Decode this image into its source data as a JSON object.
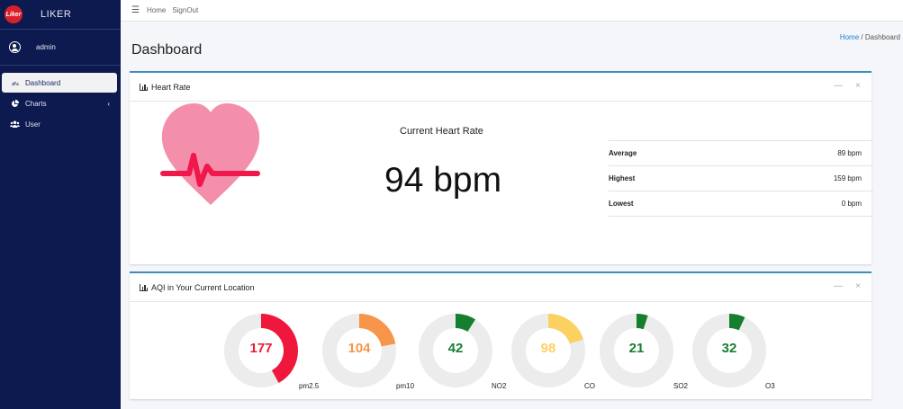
{
  "brand": {
    "name": "LIKER",
    "logo_text": "Liker"
  },
  "user": {
    "name": "admin"
  },
  "sidebar": {
    "items": [
      {
        "label": "Dashboard",
        "icon": "dashboard-icon"
      },
      {
        "label": "Charts",
        "icon": "pie-chart-icon"
      },
      {
        "label": "User",
        "icon": "users-icon"
      }
    ]
  },
  "topbar": {
    "home": "Home",
    "signout": "SignOut"
  },
  "page": {
    "title": "Dashboard"
  },
  "breadcrumb": {
    "home": "Home",
    "separator": "/",
    "current": "Dashboard"
  },
  "heart_card": {
    "title": "Heart Rate",
    "current_label": "Current Heart Rate",
    "current_value": "94 bpm",
    "stats": [
      {
        "label": "Average",
        "value": "89 bpm"
      },
      {
        "label": "Highest",
        "value": "159 bpm"
      },
      {
        "label": "Lowest",
        "value": "0 bpm"
      }
    ]
  },
  "aqi_card": {
    "title": "AQI in Your Current Location",
    "gauges": [
      {
        "value": "177",
        "label": "pm2.5",
        "fraction": 0.42,
        "color": "#f0173d"
      },
      {
        "value": "104",
        "label": "pm10",
        "fraction": 0.22,
        "color": "#f7954a"
      },
      {
        "value": "42",
        "label": "NO2",
        "fraction": 0.09,
        "color": "#157f2f"
      },
      {
        "value": "98",
        "label": "CO",
        "fraction": 0.2,
        "color": "#fdd062"
      },
      {
        "value": "21",
        "label": "SO2",
        "fraction": 0.05,
        "color": "#157f2f"
      },
      {
        "value": "32",
        "label": "O3",
        "fraction": 0.07,
        "color": "#157f2f"
      }
    ]
  },
  "colors": {
    "sidebar_bg": "#0d1a4f",
    "accent": "#3c8dbc",
    "heart_pink": "#f48fab",
    "heart_line": "#f0174a"
  }
}
